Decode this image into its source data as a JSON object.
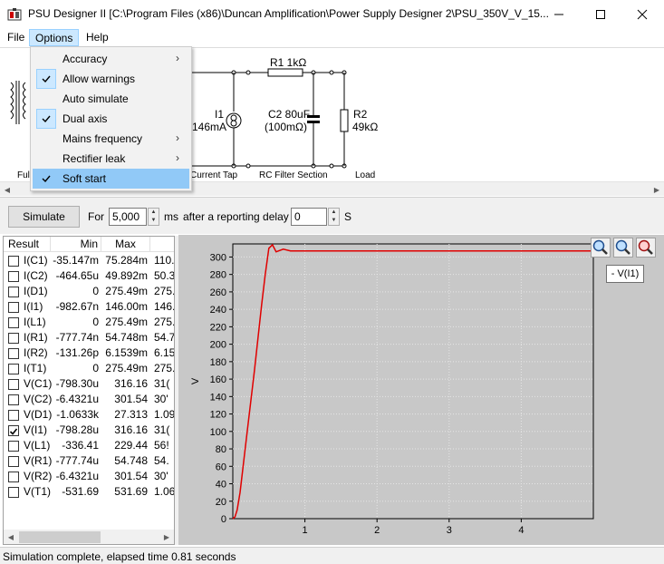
{
  "window": {
    "title": "PSU Designer II  [C:\\Program Files (x86)\\Duncan Amplification\\Power Supply Designer 2\\PSU_350V_V_15..."
  },
  "menubar": {
    "items": [
      {
        "label": "File"
      },
      {
        "label": "Options"
      },
      {
        "label": "Help"
      }
    ]
  },
  "options_menu": {
    "items": [
      {
        "label": "Accuracy",
        "checked": false,
        "submenu": true
      },
      {
        "label": "Allow warnings",
        "checked": true,
        "submenu": false
      },
      {
        "label": "Auto simulate",
        "checked": false,
        "submenu": false
      },
      {
        "label": "Dual axis",
        "checked": true,
        "submenu": false
      },
      {
        "label": "Mains frequency",
        "checked": false,
        "submenu": true
      },
      {
        "label": "Rectifier leak",
        "checked": false,
        "submenu": true
      },
      {
        "label": "Soft start",
        "checked": true,
        "submenu": false,
        "highlighted": true
      }
    ]
  },
  "schematic": {
    "r1_label": "R1 1kΩ",
    "i1_label": "I1",
    "i1_value": "146mA",
    "c2_label": "C2 80uF",
    "c2_esr": "(100mΩ)",
    "r2_label": "R2",
    "r2_value": "49kΩ",
    "full_label": "Ful",
    "section_current_tap": "Current Tap",
    "section_rc_filter": "RC Filter Section",
    "section_load": "Load"
  },
  "toolbar": {
    "simulate_label": "Simulate",
    "for_label": "For",
    "duration_value": "5,000",
    "ms_label": "ms",
    "delay_label": "after a reporting delay of",
    "delay_value": "0",
    "s_label": "S"
  },
  "results": {
    "columns": [
      "Result",
      "Min",
      "Max"
    ],
    "rows": [
      {
        "name": "I(C1)",
        "min": "-35.147m",
        "max": "75.284m",
        "extra": "110.",
        "checked": false
      },
      {
        "name": "I(C2)",
        "min": "-464.65u",
        "max": "49.892m",
        "extra": "50.3",
        "checked": false
      },
      {
        "name": "I(D1)",
        "min": "0",
        "max": "275.49m",
        "extra": "275.",
        "checked": false
      },
      {
        "name": "I(I1)",
        "min": "-982.67n",
        "max": "146.00m",
        "extra": "146.",
        "checked": false
      },
      {
        "name": "I(L1)",
        "min": "0",
        "max": "275.49m",
        "extra": "275.",
        "checked": false
      },
      {
        "name": "I(R1)",
        "min": "-777.74n",
        "max": "54.748m",
        "extra": "54.7",
        "checked": false
      },
      {
        "name": "I(R2)",
        "min": "-131.26p",
        "max": "6.1539m",
        "extra": "6.15",
        "checked": false
      },
      {
        "name": "I(T1)",
        "min": "0",
        "max": "275.49m",
        "extra": "275.",
        "checked": false
      },
      {
        "name": "V(C1)",
        "min": "-798.30u",
        "max": "316.16",
        "extra": "31(",
        "checked": false
      },
      {
        "name": "V(C2)",
        "min": "-6.4321u",
        "max": "301.54",
        "extra": "30'",
        "checked": false
      },
      {
        "name": "V(D1)",
        "min": "-1.0633k",
        "max": "27.313",
        "extra": "1.09",
        "checked": false
      },
      {
        "name": "V(I1)",
        "min": "-798.28u",
        "max": "316.16",
        "extra": "31(",
        "checked": true
      },
      {
        "name": "V(L1)",
        "min": "-336.41",
        "max": "229.44",
        "extra": "56!",
        "checked": false
      },
      {
        "name": "V(R1)",
        "min": "-777.74u",
        "max": "54.748",
        "extra": "54.",
        "checked": false
      },
      {
        "name": "V(R2)",
        "min": "-6.4321u",
        "max": "301.54",
        "extra": "30'",
        "checked": false
      },
      {
        "name": "V(T1)",
        "min": "-531.69",
        "max": "531.69",
        "extra": "1.06",
        "checked": false
      }
    ]
  },
  "graph": {
    "legend_label": "- V(I1)",
    "zoom_buttons": [
      "zoom-in-icon",
      "zoom-fit-icon",
      "zoom-out-icon"
    ]
  },
  "chart_data": {
    "type": "line",
    "title": "",
    "xlabel": "",
    "ylabel": "V",
    "xlim": [
      0,
      5
    ],
    "ylim": [
      0,
      315
    ],
    "x_ticks": [
      "1",
      "2",
      "3",
      "4"
    ],
    "y_ticks": [
      "0",
      "20",
      "40",
      "60",
      "80",
      "100",
      "120",
      "140",
      "160",
      "180",
      "200",
      "220",
      "240",
      "260",
      "280",
      "300"
    ],
    "grid": true,
    "series": [
      {
        "name": "V(I1)",
        "color": "#e00000",
        "x": [
          0,
          0.03,
          0.06,
          0.1,
          0.2,
          0.3,
          0.4,
          0.45,
          0.5,
          0.55,
          0.6,
          0.7,
          0.8,
          1.0,
          2.0,
          3.0,
          4.0,
          5.0
        ],
        "y": [
          0,
          2,
          10,
          30,
          100,
          170,
          245,
          280,
          310,
          314,
          306,
          309,
          307,
          307,
          307,
          307,
          307,
          307
        ]
      }
    ]
  },
  "status": {
    "text": "Simulation complete, elapsed time 0.81 seconds"
  },
  "colors": {
    "accent": "#91c9f7",
    "trace": "#e00000",
    "plot_bg": "#c8c8c8"
  }
}
